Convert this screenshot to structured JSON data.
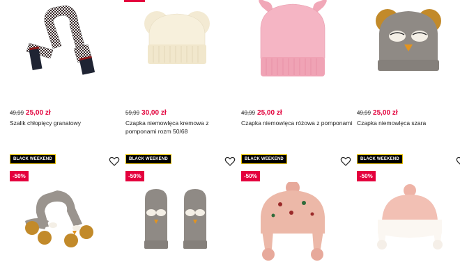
{
  "colors": {
    "sale_red": "#e2003b",
    "badge_black": "#000000"
  },
  "row1": [
    {
      "old_price": "49,99",
      "new_price": "25,00 zł",
      "name": "Szalik chłopięcy granatowy",
      "image_icon": "scarf-icon"
    },
    {
      "old_price": "59,99",
      "new_price": "30,00 zł",
      "name": "Czapka niemowlęca kremowa z pomponami rozm 50/68",
      "image_icon": "cream-hat-icon"
    },
    {
      "old_price": "49,99",
      "new_price": "25,00 zł",
      "name": "Czapka niemowlęca różowa z pomponami",
      "image_icon": "pink-hat-icon"
    },
    {
      "old_price": "49,99",
      "new_price": "25,00 zł",
      "name": "Czapka niemowlęca szara",
      "image_icon": "owl-hat-icon"
    }
  ],
  "row2": [
    {
      "badge": "BLACK WEEKEND",
      "discount": "-50%",
      "image_icon": "owl-scarf-icon",
      "wishlist_icon": "heart-icon"
    },
    {
      "badge": "BLACK WEEKEND",
      "discount": "-50%",
      "image_icon": "owl-mittens-icon",
      "wishlist_icon": "heart-icon"
    },
    {
      "badge": "BLACK WEEKEND",
      "discount": "-50%",
      "image_icon": "pink-earflap-hat-icon",
      "wishlist_icon": "heart-icon"
    },
    {
      "badge": "BLACK WEEKEND",
      "discount": "-50%",
      "image_icon": "pink-white-hat-icon",
      "wishlist_icon": "heart-icon"
    }
  ]
}
